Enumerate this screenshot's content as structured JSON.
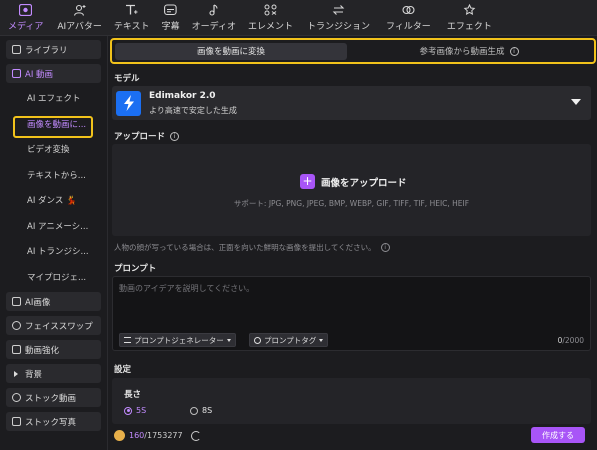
{
  "toolbar": {
    "items": [
      {
        "label": "メディア",
        "icon": "media-icon",
        "active": true
      },
      {
        "label": "AIアバター",
        "icon": "ai-avatar-icon"
      },
      {
        "label": "テキスト",
        "icon": "text-icon"
      },
      {
        "label": "字幕",
        "icon": "subtitle-icon"
      },
      {
        "label": "オーディオ",
        "icon": "audio-icon"
      },
      {
        "label": "エレメント",
        "icon": "element-icon"
      },
      {
        "label": "トランジション",
        "icon": "transition-icon"
      },
      {
        "label": "フィルター",
        "icon": "filter-icon"
      },
      {
        "label": "エフェクト",
        "icon": "effect-icon"
      }
    ]
  },
  "sidebar": {
    "library": "ライブラリ",
    "ai_video": "AI 動画",
    "sub": [
      "AI エフェクト",
      "画像を動画に...",
      "ビデオ変換",
      "テキストから...",
      "AI ダンス 💃",
      "AI アニメーシ...",
      "AI トランジシ...",
      "マイプロジェ..."
    ],
    "ai_image": "AI画像",
    "face_swap": "フェイススワップ",
    "video_enhance": "動画強化",
    "background": "背景",
    "stock_video": "ストック動画",
    "stock_photo": "ストック写真"
  },
  "tabs": {
    "active": "画像を動画に変換",
    "inactive": "参考画像から動画生成",
    "info_glyph": "i"
  },
  "model": {
    "label": "モデル",
    "name": "Edimakor 2.0",
    "desc": "より高速で安定した生成"
  },
  "upload": {
    "label": "アップロード",
    "info_glyph": "i",
    "plus": "+",
    "button": "画像をアップロード",
    "support": "サポート: JPG, PNG, JPEG, BMP, WEBP, GIF, TIFF, TIF, HEIC, HEIF",
    "notice": "人物の顔が写っている場合は、正面を向いた鮮明な画像を提出してください。"
  },
  "prompt": {
    "label": "プロンプト",
    "placeholder": "動画のアイデアを説明してください。",
    "generator": "プロンプトジェネレーター",
    "tags": "プロンプトタグ",
    "count": "0",
    "max": "/2000"
  },
  "settings": {
    "label": "設定",
    "length_label": "長さ",
    "opt_5s": "5S",
    "opt_8s": "8S"
  },
  "footer": {
    "credits_used": "160",
    "credits_total": "/1753277",
    "create": "作成する"
  },
  "colors": {
    "accent": "#a855f7",
    "highlight": "#f1c21b"
  }
}
